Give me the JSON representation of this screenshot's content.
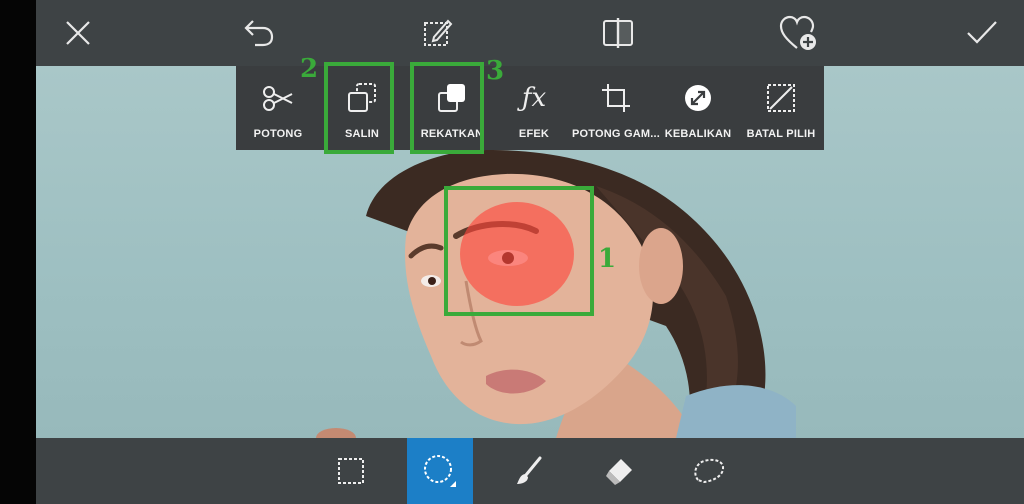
{
  "toolbar": {
    "close_icon": "close-icon",
    "undo_icon": "undo-icon",
    "draw_icon": "draw-icon",
    "compare_icon": "compare-icon",
    "favorite_icon": "heart-plus-icon",
    "apply_icon": "check-icon"
  },
  "selection_menu": {
    "items": [
      {
        "label": "POTONG",
        "icon": "scissors-icon"
      },
      {
        "label": "SALIN",
        "icon": "copy-icon"
      },
      {
        "label": "REKATKAN",
        "icon": "paste-icon"
      },
      {
        "label": "EFEK",
        "icon": "fx-icon"
      },
      {
        "label": "POTONG GAM...",
        "icon": "crop-icon"
      },
      {
        "label": "KEBALIKAN",
        "icon": "invert-icon"
      },
      {
        "label": "BATAL PILIH",
        "icon": "deselect-icon"
      }
    ]
  },
  "annotations": [
    "1",
    "2",
    "3"
  ],
  "bottom_tools": [
    {
      "name": "rectangle-select",
      "icon": "rectangle-select-icon",
      "active": false
    },
    {
      "name": "ellipse-select",
      "icon": "ellipse-select-icon",
      "active": true
    },
    {
      "name": "brush",
      "icon": "brush-icon",
      "active": false
    },
    {
      "name": "eraser",
      "icon": "eraser-icon",
      "active": false
    },
    {
      "name": "lasso",
      "icon": "lasso-icon",
      "active": false
    }
  ],
  "colors": {
    "toolbar_bg": "#3e4345",
    "menu_bg": "#3a3d3f",
    "active_tool": "#1c7fc7",
    "annotation": "#3aaa3a",
    "selection_overlay": "#ff5a4e"
  }
}
